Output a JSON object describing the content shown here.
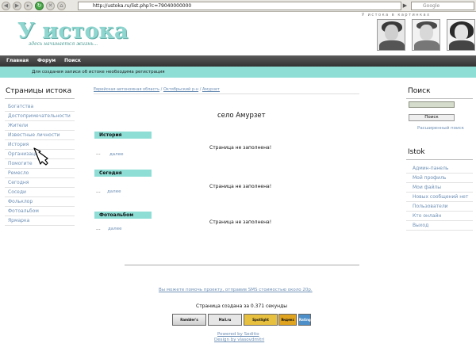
{
  "browser": {
    "url": "http://ustoka.ru/list.php?c=79040000000",
    "search_placeholder": "Google"
  },
  "header": {
    "logo": "У истока",
    "tagline": "здесь начинается жизнь...",
    "photos_caption": "У истока в картинках"
  },
  "nav": {
    "items": [
      "Главная",
      "Форум",
      "Поиск"
    ],
    "notice": "Для создания записи об истоке необходима регистрация"
  },
  "left": {
    "title": "Страницы истока",
    "items": [
      "Богатства",
      "Достопримечательности",
      "Жители",
      "Известные личности",
      "История",
      "Организации",
      "Помогите",
      "Ремесло",
      "Сегодня",
      "Соседи",
      "Фольклор",
      "Фотоальбом",
      "Ярмарка"
    ]
  },
  "main": {
    "breadcrumb": [
      "Еврейская автономная область",
      "Октябрьский р-н",
      "Амурзет"
    ],
    "heading": "село Амурзет",
    "sections": [
      {
        "title": "История",
        "more": "далее",
        "dots": "...",
        "empty": "Страница не заполнена!"
      },
      {
        "title": "Сегодня",
        "more": "далее",
        "dots": "...",
        "empty": "Страница не заполнена!"
      },
      {
        "title": "Фотоальбом",
        "more": "далее",
        "dots": "...",
        "empty": "Страница не заполнена!"
      }
    ],
    "sms_text": "Вы можете помочь проекту, отправив SMS стоимостью около 20р.",
    "generated": "Страница создана за 0.371 секунды",
    "powered": "Powered by Seditio",
    "design": "Design by vlasovdmitri"
  },
  "right": {
    "search_title": "Поиск",
    "search_button": "Поиск",
    "advanced_search": "Расширенный поиск",
    "istok_title": "Istok",
    "istok_items": [
      "Админ-панель",
      "Мой профиль",
      "Мои файлы",
      "Новых сообщений нет",
      "Пользователи",
      "Кто онлайн",
      "Выход"
    ]
  },
  "counters": [
    "Rambler's",
    "Mail.ru",
    "Spotlight",
    "Яндекс",
    "Rating"
  ],
  "colors": {
    "accent": "#8fded6",
    "nav": "#3f3f3f",
    "link": "#6d8fb5"
  }
}
